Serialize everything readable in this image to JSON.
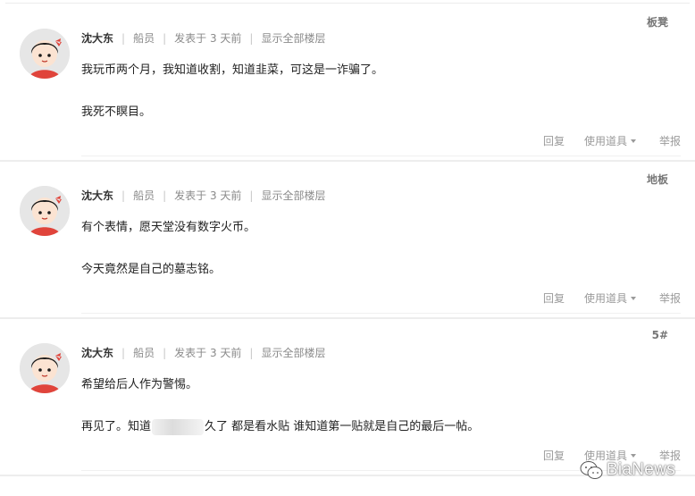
{
  "posts": [
    {
      "floor": "板凳",
      "author": "沈大东",
      "role": "船员",
      "posted": "发表于 3 天前",
      "show_all": "显示全部楼层",
      "line1": "我玩币两个月，我知道收割，知道韭菜，可这是一诈骗了。",
      "line2_a": "我死不瞑目。",
      "line2_b": "",
      "reply": "回复",
      "tools": "使用道具",
      "report": "举报"
    },
    {
      "floor": "地板",
      "author": "沈大东",
      "role": "船员",
      "posted": "发表于 3 天前",
      "show_all": "显示全部楼层",
      "line1": "有个表情，愿天堂没有数字火币。",
      "line2_a": "今天竟然是自己的墓志铭。",
      "line2_b": "",
      "reply": "回复",
      "tools": "使用道具",
      "report": "举报"
    },
    {
      "floor": "5#",
      "author": "沈大东",
      "role": "船员",
      "posted": "发表于 3 天前",
      "show_all": "显示全部楼层",
      "line1": "希望给后人作为警惕。",
      "line2_a": "再见了。知道",
      "line2_b": "久了 都是看水贴 谁知道第一贴就是自己的最后一帖。",
      "reply": "回复",
      "tools": "使用道具",
      "report": "举报"
    }
  ],
  "watermark": {
    "text": "BiaNews",
    "icon": "wechat-icon"
  },
  "colors": {
    "accent_text": "#333333",
    "muted_text": "#8a8a8a",
    "avatar_shirt": "#e0443b",
    "avatar_bow": "#e0443b"
  }
}
